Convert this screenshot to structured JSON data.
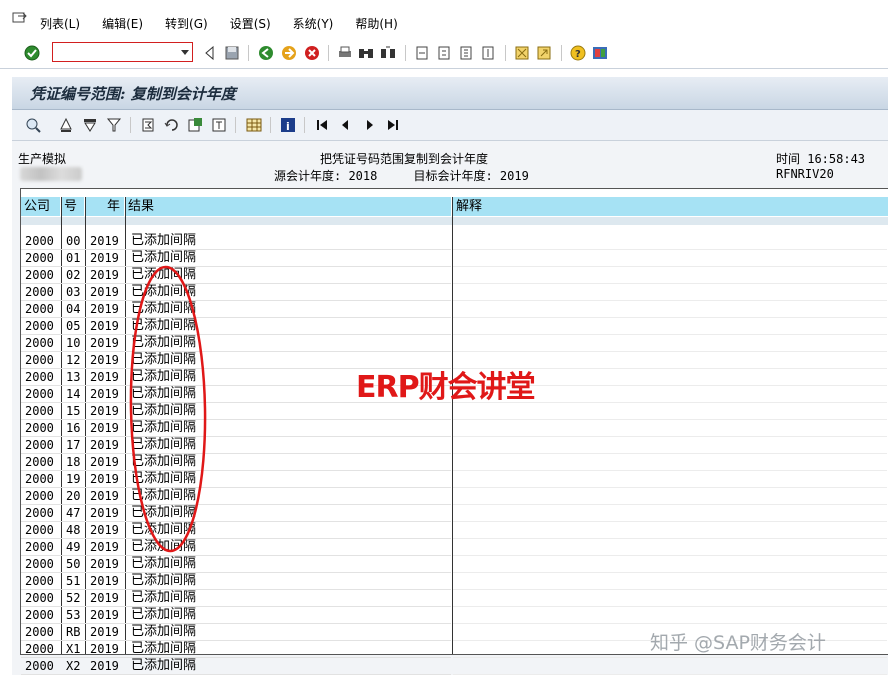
{
  "menu": {
    "items": [
      "列表(L)",
      "编辑(E)",
      "转到(G)",
      "设置(S)",
      "系统(Y)",
      "帮助(H)"
    ]
  },
  "command_field": {
    "value": ""
  },
  "screen": {
    "title": "凭证编号范围: 复制到会计年度"
  },
  "report_header": {
    "left_line1": "生产模拟",
    "center_line1": "把凭证号码范围复制到会计年度",
    "center_line2": "源会计年度: 2018     目标会计年度: 2019",
    "right_line1": "时间 16:58:43",
    "right_line2": "RFNRIV20"
  },
  "table": {
    "columns": {
      "company": "公司",
      "number": "号",
      "year": "年",
      "result": "结果",
      "explanation": "解释"
    },
    "rows": [
      {
        "company": "2000",
        "number": "00",
        "year": "2019",
        "result": "已添加间隔"
      },
      {
        "company": "2000",
        "number": "01",
        "year": "2019",
        "result": "已添加间隔"
      },
      {
        "company": "2000",
        "number": "02",
        "year": "2019",
        "result": "已添加间隔"
      },
      {
        "company": "2000",
        "number": "03",
        "year": "2019",
        "result": "已添加间隔"
      },
      {
        "company": "2000",
        "number": "04",
        "year": "2019",
        "result": "已添加间隔"
      },
      {
        "company": "2000",
        "number": "05",
        "year": "2019",
        "result": "已添加间隔"
      },
      {
        "company": "2000",
        "number": "10",
        "year": "2019",
        "result": "已添加间隔"
      },
      {
        "company": "2000",
        "number": "12",
        "year": "2019",
        "result": "已添加间隔"
      },
      {
        "company": "2000",
        "number": "13",
        "year": "2019",
        "result": "已添加间隔"
      },
      {
        "company": "2000",
        "number": "14",
        "year": "2019",
        "result": "已添加间隔"
      },
      {
        "company": "2000",
        "number": "15",
        "year": "2019",
        "result": "已添加间隔"
      },
      {
        "company": "2000",
        "number": "16",
        "year": "2019",
        "result": "已添加间隔"
      },
      {
        "company": "2000",
        "number": "17",
        "year": "2019",
        "result": "已添加间隔"
      },
      {
        "company": "2000",
        "number": "18",
        "year": "2019",
        "result": "已添加间隔"
      },
      {
        "company": "2000",
        "number": "19",
        "year": "2019",
        "result": "已添加间隔"
      },
      {
        "company": "2000",
        "number": "20",
        "year": "2019",
        "result": "已添加间隔"
      },
      {
        "company": "2000",
        "number": "47",
        "year": "2019",
        "result": "已添加间隔"
      },
      {
        "company": "2000",
        "number": "48",
        "year": "2019",
        "result": "已添加间隔"
      },
      {
        "company": "2000",
        "number": "49",
        "year": "2019",
        "result": "已添加间隔"
      },
      {
        "company": "2000",
        "number": "50",
        "year": "2019",
        "result": "已添加间隔"
      },
      {
        "company": "2000",
        "number": "51",
        "year": "2019",
        "result": "已添加间隔"
      },
      {
        "company": "2000",
        "number": "52",
        "year": "2019",
        "result": "已添加间隔"
      },
      {
        "company": "2000",
        "number": "53",
        "year": "2019",
        "result": "已添加间隔"
      },
      {
        "company": "2000",
        "number": "RB",
        "year": "2019",
        "result": "已添加间隔"
      },
      {
        "company": "2000",
        "number": "X1",
        "year": "2019",
        "result": "已添加间隔"
      },
      {
        "company": "2000",
        "number": "X2",
        "year": "2019",
        "result": "已添加间隔"
      }
    ]
  },
  "overlays": {
    "watermark_main": "ERP财会讲堂",
    "watermark_corner": "知乎 @SAP财务会计",
    "annotation_color": "#e01818"
  }
}
